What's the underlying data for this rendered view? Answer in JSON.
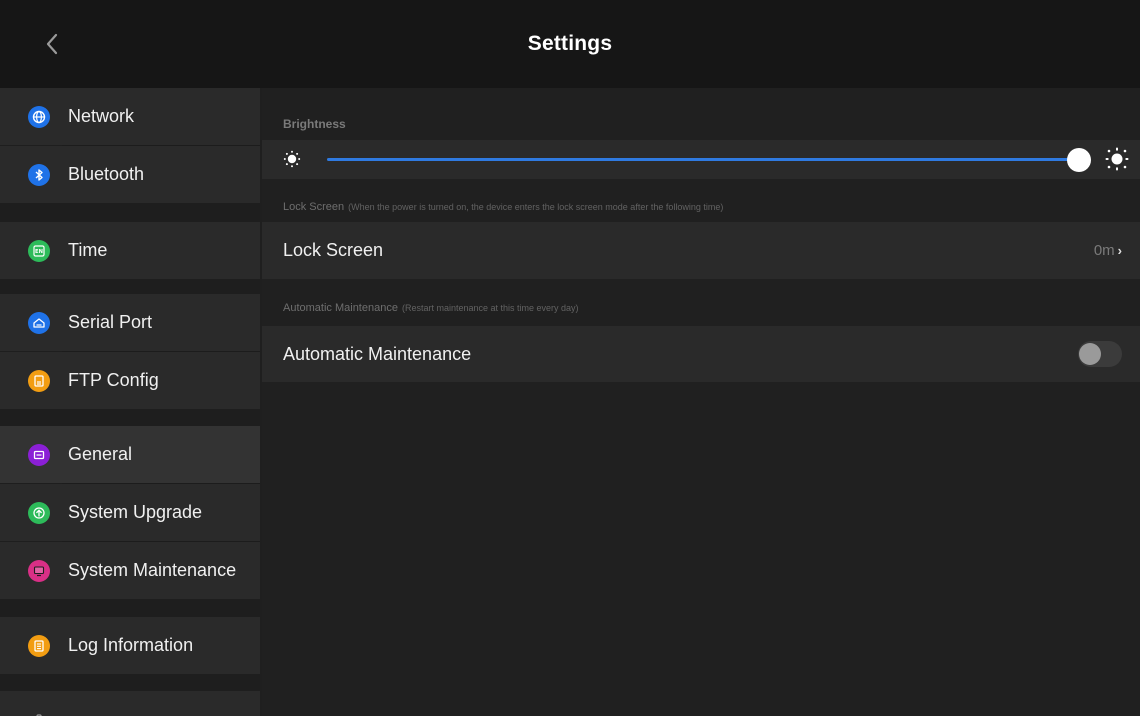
{
  "header": {
    "title": "Settings"
  },
  "sidebar": {
    "items": [
      {
        "label": "Network",
        "icon": "globe-icon",
        "color": "#1f72e8"
      },
      {
        "label": "Bluetooth",
        "icon": "bluetooth-icon",
        "color": "#1f72e8"
      },
      {
        "label": "Time",
        "icon": "language-icon",
        "color": "#2dbb5a"
      },
      {
        "label": "Serial Port",
        "icon": "serial-port-icon",
        "color": "#1f72e8"
      },
      {
        "label": "FTP Config",
        "icon": "file-icon",
        "color": "#f29d12"
      },
      {
        "label": "General",
        "icon": "general-icon",
        "color": "#8b1fd6"
      },
      {
        "label": "System Upgrade",
        "icon": "upgrade-icon",
        "color": "#2dbb5a"
      },
      {
        "label": "System Maintenance",
        "icon": "monitor-icon",
        "color": "#d92f86"
      },
      {
        "label": "Log Information",
        "icon": "document-icon",
        "color": "#f29d12"
      }
    ],
    "active_index": 5
  },
  "content": {
    "brightness": {
      "label": "Brightness",
      "value_percent": 100,
      "track_color": "#2f7ae0"
    },
    "lock_screen": {
      "section_title": "Lock Screen",
      "section_note": "(When the power is turned on, the device enters the lock screen mode after the following time)",
      "label": "Lock Screen",
      "value": "0m",
      "chevron": "›"
    },
    "auto_maintenance": {
      "section_title": "Automatic Maintenance",
      "section_note": "(Restart maintenance at this time every day)",
      "label": "Automatic Maintenance",
      "enabled": false
    }
  }
}
